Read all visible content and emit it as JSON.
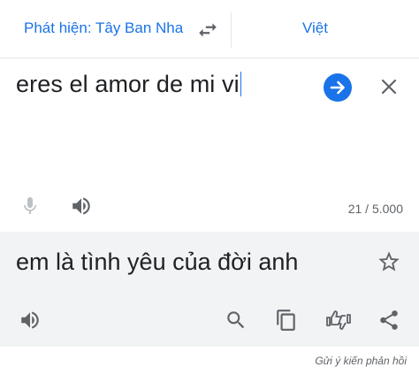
{
  "language_bar": {
    "source_label": "Phát hiện: Tây Ban Nha",
    "target_label": "Việt",
    "swap_icon": "swap-arrows-icon"
  },
  "input": {
    "text": "eres el amor de mi vi",
    "char_count": "21 / 5.000"
  },
  "output": {
    "text": "em là tình yêu của đời anh"
  },
  "footer": {
    "feedback_label": "Gửi ý kiến phản hồi"
  },
  "colors": {
    "accent": "#1a73e8",
    "icon": "#5f6368",
    "icon_disabled": "#bdc1c6",
    "output_bg": "#f1f3f4"
  }
}
